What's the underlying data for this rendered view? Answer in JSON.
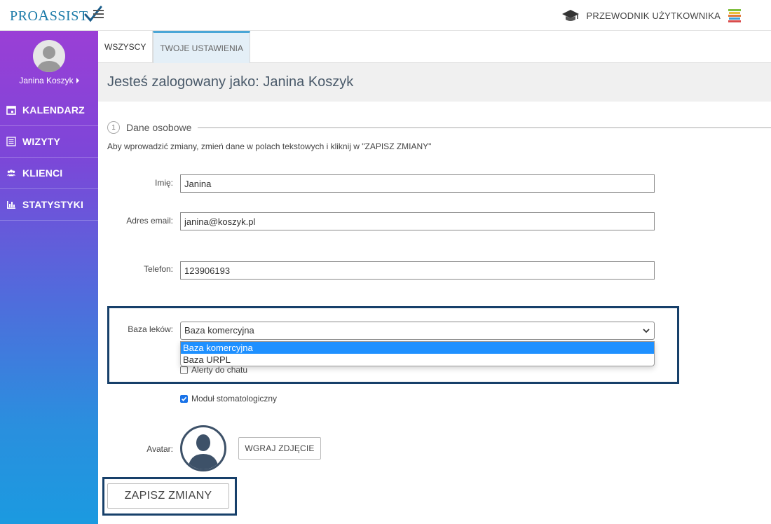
{
  "app": {
    "logo_text_a": "PRO",
    "logo_text_b": "A",
    "logo_text_c": "SSIST"
  },
  "header": {
    "guide_label": "PRZEWODNIK UŻYTKOWNIKA"
  },
  "sidebar": {
    "user_name": "Janina Koszyk",
    "items": [
      {
        "label": "KALENDARZ",
        "icon": "calendar-icon"
      },
      {
        "label": "WIZYTY",
        "icon": "list-icon"
      },
      {
        "label": "KLIENCI",
        "icon": "users-icon"
      },
      {
        "label": "STATYSTYKI",
        "icon": "bar-chart-icon"
      }
    ]
  },
  "tabs": [
    {
      "label": "WSZYSCY",
      "active": false
    },
    {
      "label": "TWOJE USTAWIENIA",
      "active": true
    }
  ],
  "banner": {
    "title": "Jesteś zalogowany jako: Janina Koszyk"
  },
  "section": {
    "step": "1",
    "title": "Dane osobowe",
    "instructions": "Aby wprowadzić zmiany, zmień dane w polach tekstowych i kliknij w \"ZAPISZ ZMIANY\""
  },
  "form": {
    "first_name": {
      "label": "Imię:",
      "value": "Janina"
    },
    "email": {
      "label": "Adres email:",
      "value": "janina@koszyk.pl"
    },
    "phone": {
      "label": "Telefon:",
      "value": "123906193"
    },
    "drug_db": {
      "label": "Baza leków:",
      "selected": "Baza komercyjna",
      "options": [
        "Baza komercyjna",
        "Baza URPL"
      ]
    },
    "chat_alerts": {
      "label": "Alerty do chatu",
      "checked": false
    },
    "dental_module": {
      "label": "Moduł stomatologiczny",
      "checked": true
    },
    "avatar": {
      "label": "Avatar:",
      "upload_label": "WGRAJ ZDJĘCIE"
    },
    "save_label": "ZAPISZ ZMIANY"
  },
  "colors": {
    "highlight_border": "#17406a",
    "option_selected": "#1e90ff",
    "tab_active_border": "#4aa6d6"
  }
}
